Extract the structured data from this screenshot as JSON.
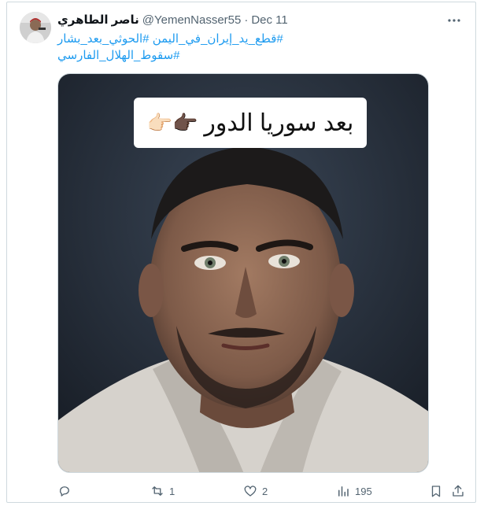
{
  "tweet": {
    "author_name": "ناصر الطاهري",
    "handle": "@YemenNasser55",
    "separator": "·",
    "date": "Dec 11",
    "more_icon": "more-horizontal-icon",
    "hashtags_line1": "#قطع_يد_إيران_في_اليمن #الحوثي_بعد_بشار",
    "hashtags_line2": "#سقوط_الهلال_الفارسي",
    "image_caption": "بعد سوريا الدور",
    "image_caption_emoji": "👉🏿👉🏻"
  },
  "actions": {
    "reply_icon": "reply-icon",
    "reply_count": "",
    "repost_icon": "repost-icon",
    "repost_count": "1",
    "like_icon": "heart-icon",
    "like_count": "2",
    "views_icon": "views-icon",
    "views_count": "195",
    "bookmark_icon": "bookmark-icon",
    "share_icon": "share-icon"
  },
  "colors": {
    "link": "#1d9bf0",
    "muted": "#536471",
    "border": "#cfd9de"
  }
}
